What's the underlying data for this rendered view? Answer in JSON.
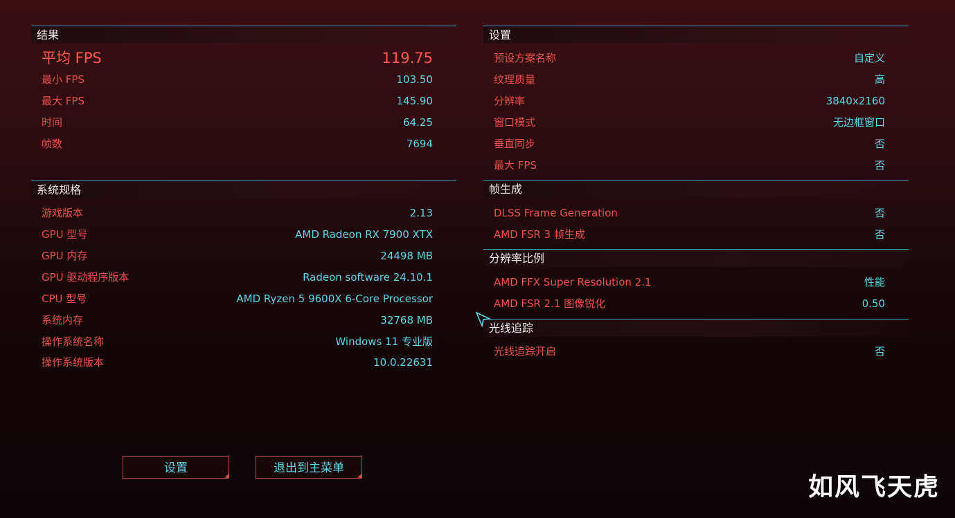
{
  "results": {
    "title": "结果",
    "rows": [
      {
        "k": "平均 FPS",
        "v": "119.75"
      },
      {
        "k": "最小 FPS",
        "v": "103.50"
      },
      {
        "k": "最大 FPS",
        "v": "145.90"
      },
      {
        "k": "时间",
        "v": "64.25"
      },
      {
        "k": "帧数",
        "v": "7694"
      }
    ]
  },
  "system": {
    "title": "系统规格",
    "rows": [
      {
        "k": "游戏版本",
        "v": "2.13"
      },
      {
        "k": "GPU 型号",
        "v": "AMD Radeon RX 7900 XTX"
      },
      {
        "k": "GPU 内存",
        "v": "24498 MB"
      },
      {
        "k": "GPU 驱动程序版本",
        "v": "Radeon software 24.10.1"
      },
      {
        "k": "CPU 型号",
        "v": "AMD Ryzen 5 9600X 6-Core Processor"
      },
      {
        "k": "系统内存",
        "v": "32768 MB"
      },
      {
        "k": "操作系统名称",
        "v": "Windows 11 专业版"
      },
      {
        "k": "操作系统版本",
        "v": "10.0.22631"
      }
    ]
  },
  "settings": {
    "title": "设置",
    "rows": [
      {
        "k": "预设方案名称",
        "v": "自定义"
      },
      {
        "k": "纹理质量",
        "v": "高"
      },
      {
        "k": "分辨率",
        "v": "3840x2160"
      },
      {
        "k": "窗口模式",
        "v": "无边框窗口"
      },
      {
        "k": "垂直同步",
        "v": "否"
      },
      {
        "k": "最大 FPS",
        "v": "否"
      }
    ]
  },
  "frame_gen": {
    "title": "帧生成",
    "rows": [
      {
        "k": "DLSS Frame Generation",
        "v": "否"
      },
      {
        "k": "AMD FSR 3 帧生成",
        "v": "否"
      }
    ]
  },
  "resolution_scaling": {
    "title": "分辨率比例",
    "rows": [
      {
        "k": "AMD FFX Super Resolution 2.1",
        "v": "性能"
      },
      {
        "k": "AMD FSR 2.1 图像锐化",
        "v": "0.50"
      }
    ]
  },
  "ray_tracing": {
    "title": "光线追踪",
    "rows": [
      {
        "k": "光线追踪开启",
        "v": "否"
      }
    ]
  },
  "buttons": {
    "settings": "设置",
    "exit_main_menu": "退出到主菜单"
  },
  "watermark": "如风飞天虎",
  "colors": {
    "accent_line": "#3aa8b8",
    "key_red": "#e8504a",
    "value_cyan": "#5fd7e6"
  }
}
